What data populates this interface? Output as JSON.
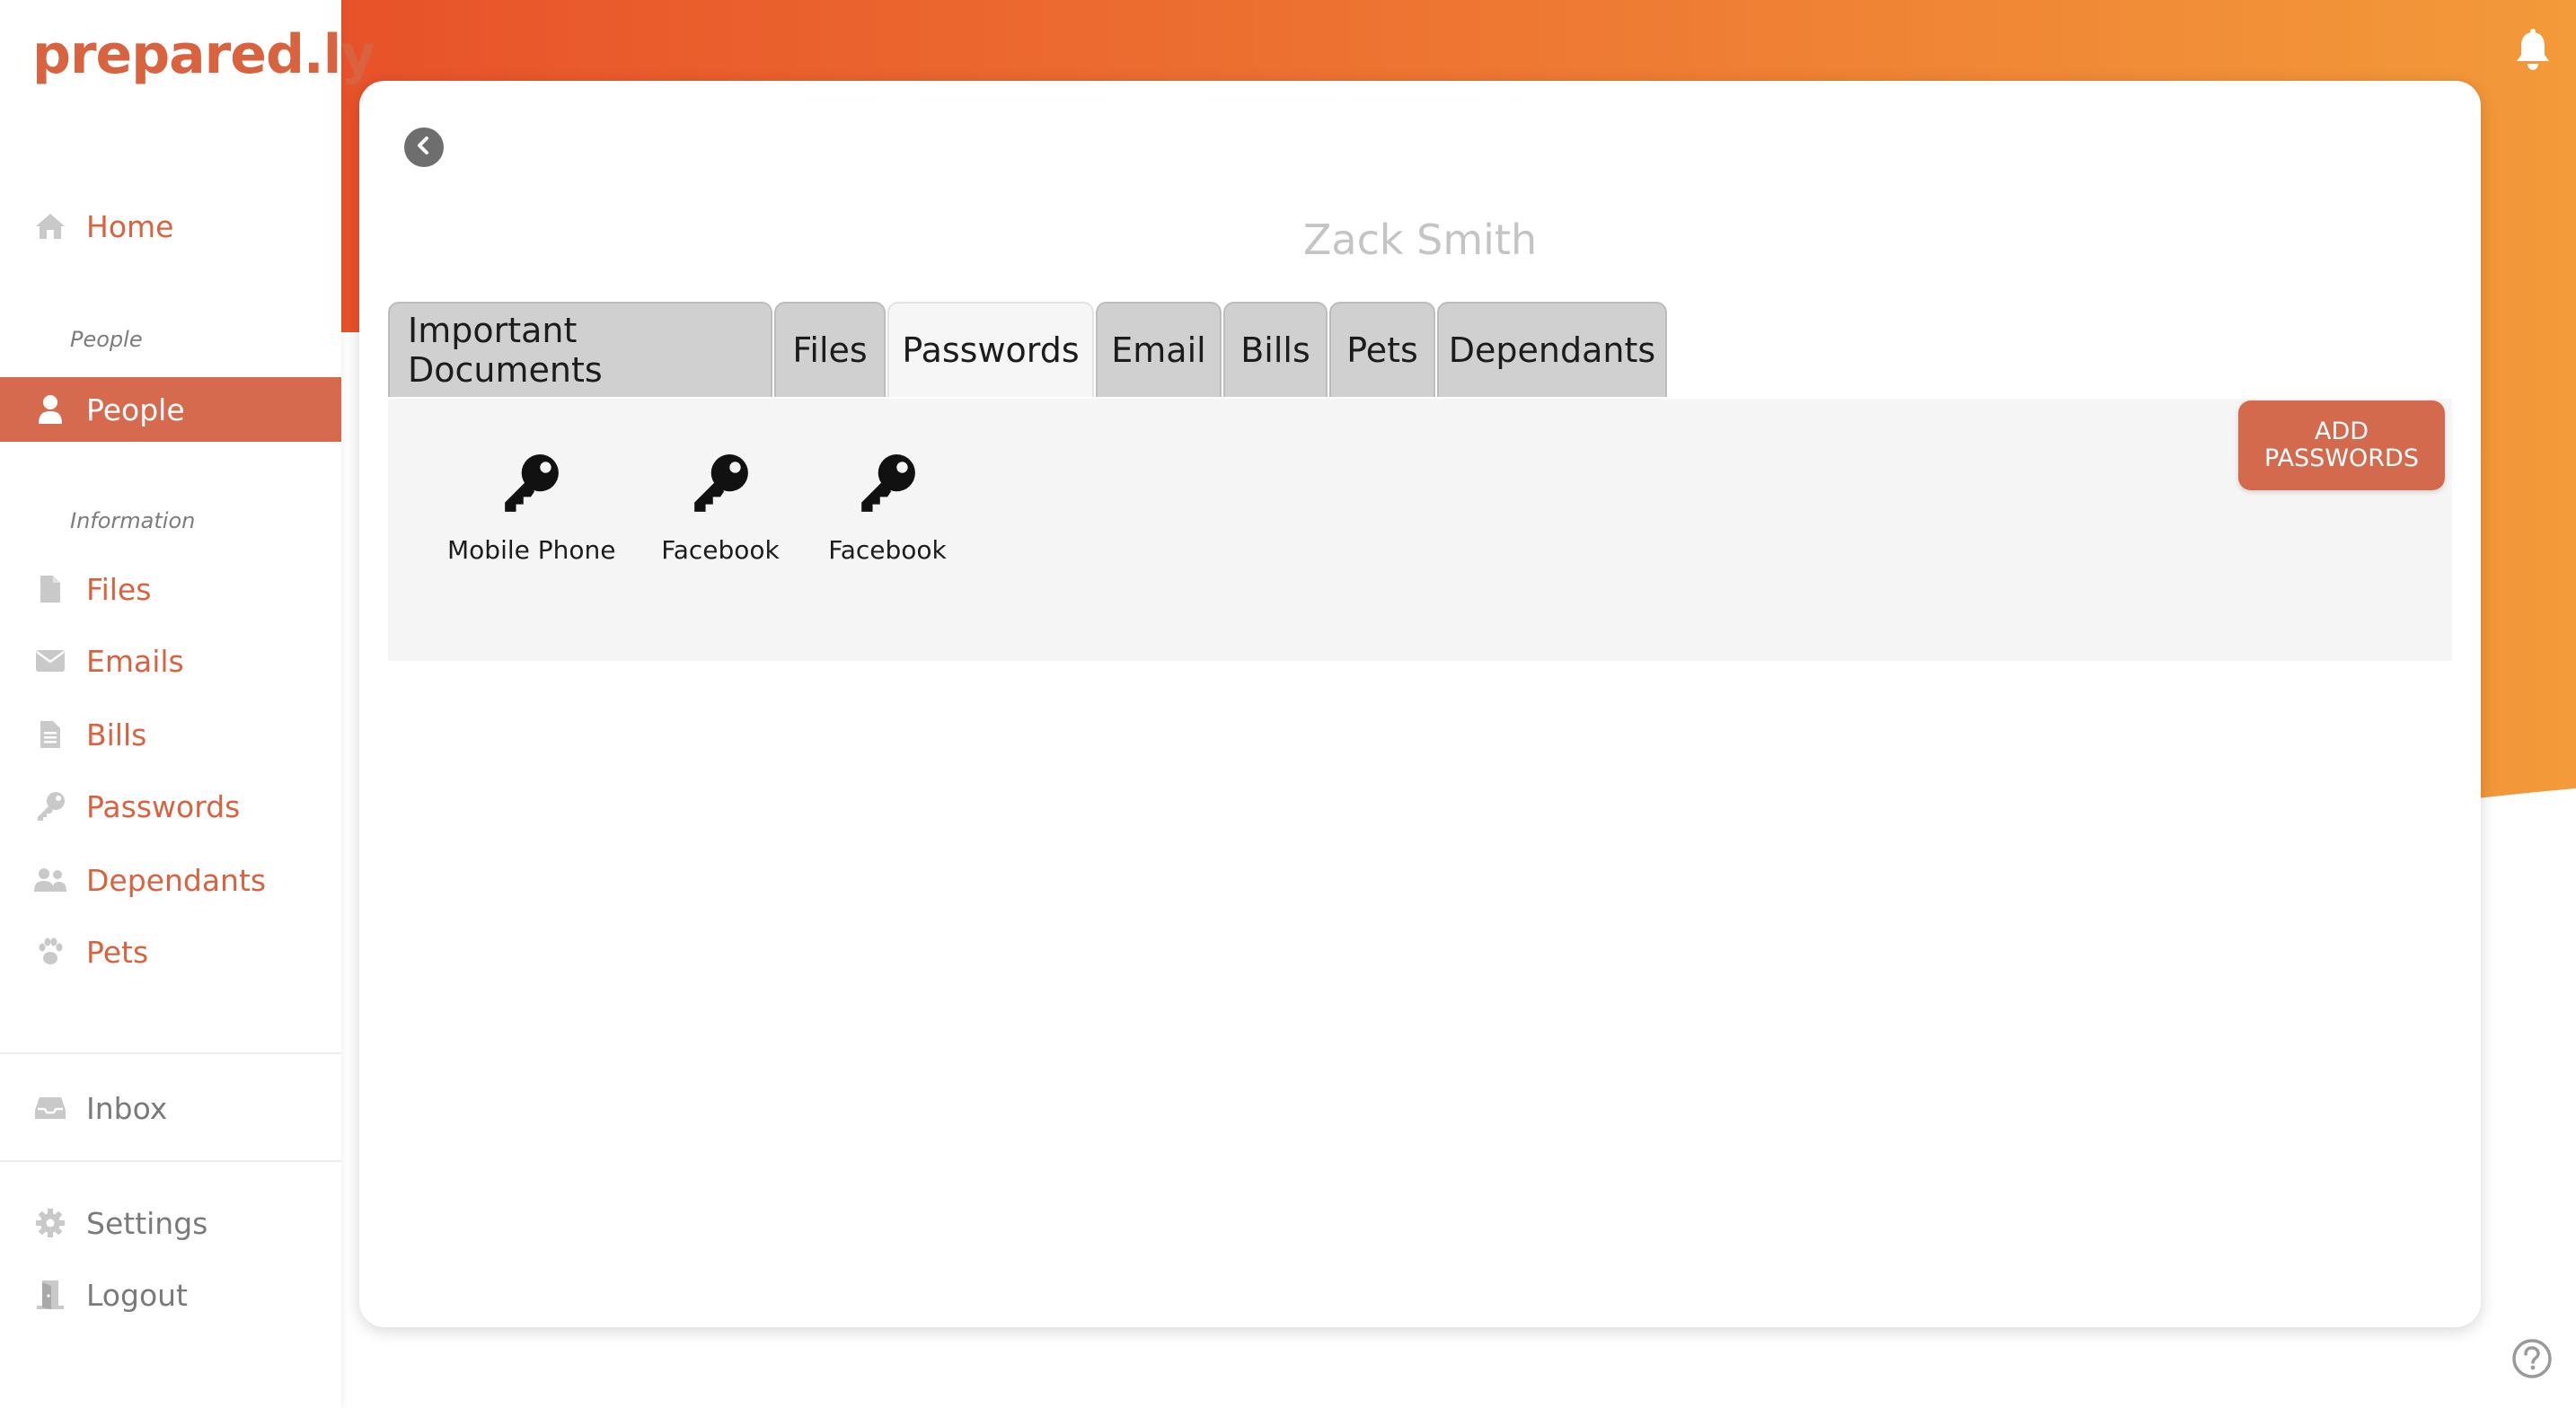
{
  "app": {
    "logo_text": "prepared.ly",
    "brand_color": "#d9623f"
  },
  "sidebar": {
    "home": "Home",
    "section_people": "People",
    "people": "People",
    "section_information": "Information",
    "files": "Files",
    "emails": "Emails",
    "bills": "Bills",
    "passwords": "Passwords",
    "dependants": "Dependants",
    "pets": "Pets",
    "inbox": "Inbox",
    "settings": "Settings",
    "logout": "Logout",
    "active_item": "People"
  },
  "main": {
    "person_name": "Zack Smith",
    "tabs": [
      {
        "label": "Important Documents"
      },
      {
        "label": "Files"
      },
      {
        "label": "Passwords"
      },
      {
        "label": "Email"
      },
      {
        "label": "Bills"
      },
      {
        "label": "Pets"
      },
      {
        "label": "Dependants"
      }
    ],
    "active_tab": "Passwords",
    "add_button": {
      "line1": "ADD",
      "line2": "PASSWORDS"
    },
    "passwords": [
      {
        "label": "Mobile Phone",
        "icon": "key-icon"
      },
      {
        "label": "Facebook",
        "icon": "key-icon"
      },
      {
        "label": "Facebook",
        "icon": "key-icon"
      }
    ]
  },
  "colors": {
    "accent": "#d56a4e",
    "gradient_start": "#e8522a",
    "gradient_end": "#f39a3a"
  }
}
